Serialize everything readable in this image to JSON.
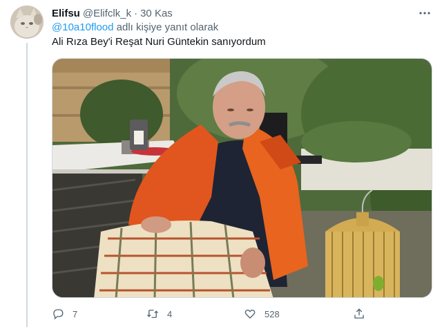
{
  "tweet": {
    "author_name": "Elifsu",
    "author_handle": "@Elifclk_k",
    "separator": "·",
    "timestamp": "30 Kas",
    "reply_mention": "@10a10flood",
    "reply_suffix": " adlı kişiye yanıt olarak",
    "text": "Ali Rıza Bey'i Reşat Nuri Güntekin sanıyordum"
  },
  "actions": {
    "reply_count": "7",
    "retweet_count": "4",
    "like_count": "528"
  },
  "icons": [
    "more-icon",
    "reply-icon",
    "retweet-icon",
    "like-icon",
    "share-icon"
  ],
  "colors": {
    "link": "#1d9bf0",
    "secondary_text": "#536471",
    "primary_text": "#0f1419",
    "border": "#cfd9de"
  }
}
